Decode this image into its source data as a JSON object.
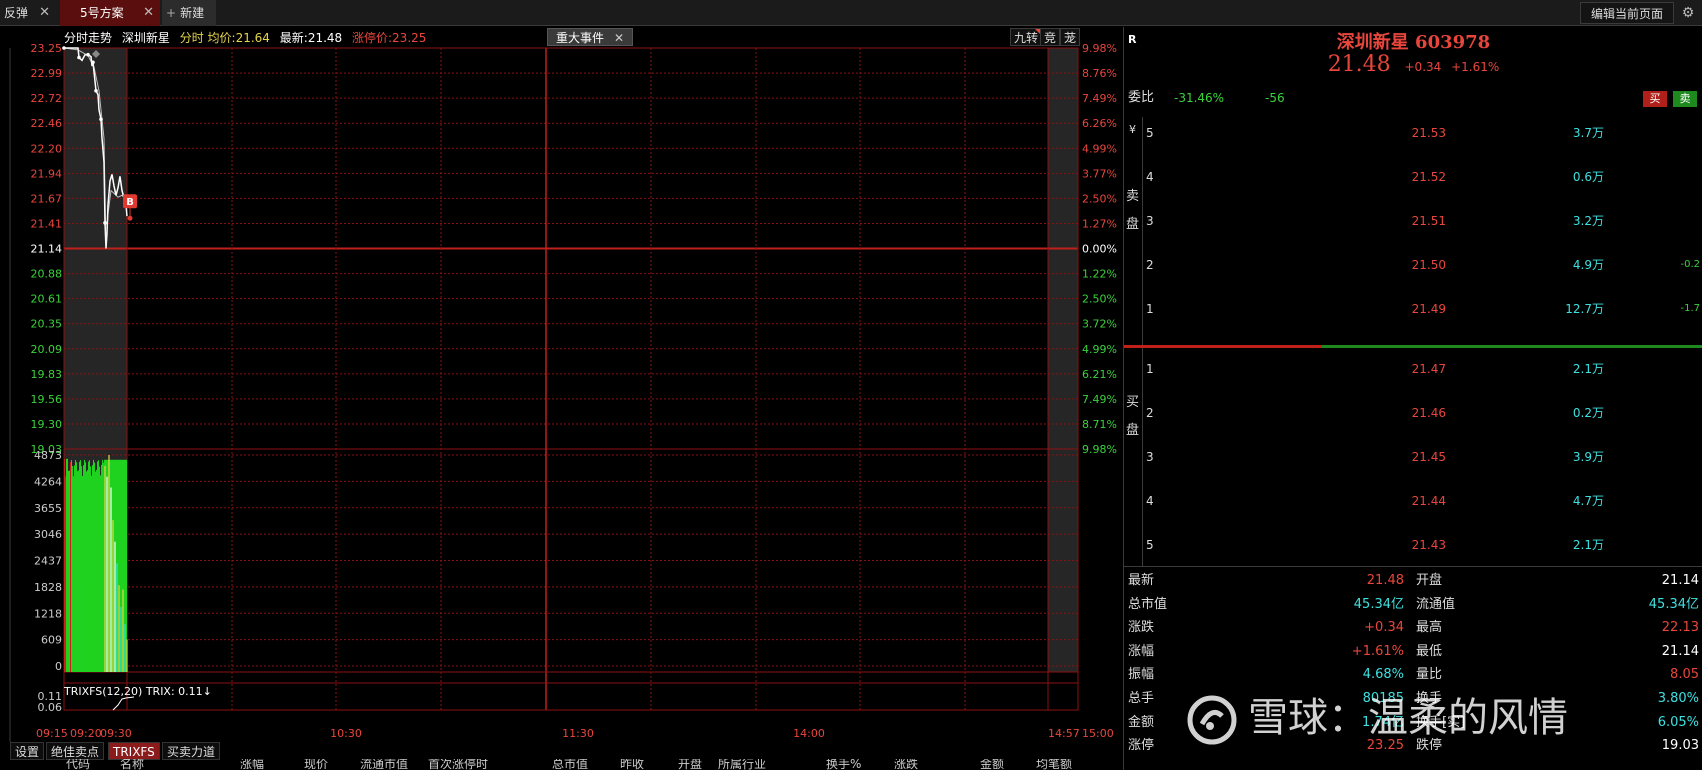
{
  "tabs": [
    {
      "label": "反弹",
      "closable": true
    },
    {
      "label": "5号方案",
      "closable": true,
      "active": true
    },
    {
      "label": "新建",
      "icon": "plus-icon"
    }
  ],
  "toolbar": {
    "edit_page": "编辑当前页面"
  },
  "chart_header": {
    "mode": "分时走势",
    "stock": "深圳新星",
    "sub": "分时",
    "avg_label": "均价:",
    "avg_value": "21.64",
    "last_label": "最新:",
    "last_value": "21.48",
    "limit_label": "涨停价:",
    "limit_value": "23.25",
    "event_tag": "重大事件",
    "btn_jiuzhuan": "九转",
    "btn_jing": "竞",
    "btn_long": "茏"
  },
  "colors": {
    "up": "#e8463c",
    "down": "#3ad23a",
    "grid": "#8c1010",
    "cyan": "#3ee0e0",
    "yellow": "#e6d54a"
  },
  "chart_data": {
    "type": "line",
    "prev_close": 21.14,
    "price_axis": {
      "left_labels": [
        "23.25",
        "22.99",
        "22.72",
        "22.46",
        "22.20",
        "21.94",
        "21.67",
        "21.41",
        "21.14",
        "20.88",
        "20.61",
        "20.35",
        "20.09",
        "19.83",
        "19.56",
        "19.30",
        "19.03"
      ],
      "right_labels": [
        "9.98%",
        "8.76%",
        "7.49%",
        "6.26%",
        "4.99%",
        "3.77%",
        "2.50%",
        "1.27%",
        "0.00%",
        "1.22%",
        "2.50%",
        "3.72%",
        "4.99%",
        "6.21%",
        "7.49%",
        "8.71%",
        "9.98%"
      ],
      "ylim": [
        19.03,
        23.25
      ]
    },
    "time_axis": {
      "labels": [
        "09:15",
        "09:20",
        "09:30",
        "10:30",
        "11:30",
        "14:00",
        "14:57",
        "15:00"
      ]
    },
    "price_series": [
      {
        "name": "price",
        "points": [
          [
            0,
            23.25
          ],
          [
            5,
            23.25
          ],
          [
            14,
            23.25
          ],
          [
            15,
            23.15
          ],
          [
            18,
            23.12
          ],
          [
            21,
            23.18
          ],
          [
            24,
            23.18
          ],
          [
            27,
            23.16
          ],
          [
            28,
            23.06
          ],
          [
            29,
            23.1
          ],
          [
            30,
            23.0
          ],
          [
            31,
            22.9
          ],
          [
            32,
            22.8
          ],
          [
            34,
            22.76
          ],
          [
            35,
            22.6
          ],
          [
            37,
            22.5
          ],
          [
            38,
            22.3
          ],
          [
            40,
            22.05
          ],
          [
            41,
            21.41
          ],
          [
            42,
            21.14
          ],
          [
            43,
            21.3
          ],
          [
            44,
            21.6
          ],
          [
            46,
            21.85
          ],
          [
            48,
            21.92
          ],
          [
            50,
            21.8
          ],
          [
            52,
            21.7
          ],
          [
            54,
            21.78
          ],
          [
            56,
            21.9
          ],
          [
            58,
            21.75
          ],
          [
            60,
            21.67
          ],
          [
            62,
            21.6
          ],
          [
            63,
            21.48
          ]
        ]
      },
      {
        "name": "avg",
        "points": [
          [
            0,
            23.25
          ],
          [
            14,
            23.23
          ],
          [
            24,
            23.17
          ],
          [
            30,
            23.05
          ],
          [
            35,
            22.8
          ],
          [
            40,
            22.3
          ],
          [
            42,
            21.14
          ],
          [
            44,
            21.5
          ],
          [
            47,
            21.75
          ],
          [
            50,
            21.72
          ],
          [
            54,
            21.68
          ],
          [
            58,
            21.7
          ],
          [
            63,
            21.64
          ]
        ]
      }
    ],
    "signal_marker": {
      "label": "B",
      "at_minute": 62
    },
    "volume_axis": {
      "labels": [
        "4873",
        "4264",
        "3655",
        "3046",
        "2437",
        "1828",
        "1218",
        "609",
        "0"
      ],
      "ylim": [
        0,
        4873
      ]
    },
    "trix_axis": {
      "labels": [
        "0.11",
        "0.06"
      ]
    },
    "indicator_label": "TRIXFS(12,20)  TRIX: 0.11↓"
  },
  "bottom_tabs": [
    "设置",
    "绝佳卖点",
    "TRIXFS",
    "买卖力道"
  ],
  "column_headers": [
    "代码",
    "名称",
    "涨幅",
    "现价",
    "流通市值",
    "首次涨停时",
    "总市值",
    "昨收",
    "开盘",
    "所属行业",
    "换手%",
    "涨跌",
    "金额",
    "均笔额"
  ],
  "quote": {
    "tag": "R",
    "name": "深圳新星 603978",
    "price": "21.48",
    "change": "+0.34",
    "change_pct": "+1.61%",
    "weibi_label": "委比",
    "weibi_pct": "-31.46%",
    "weicha": "-56",
    "buy_btn": "买",
    "sell_btn": "卖",
    "yen": "¥",
    "sell_side_label": [
      "卖",
      "盘"
    ],
    "buy_side_label": [
      "买",
      "盘"
    ],
    "asks": [
      {
        "level": "5",
        "price": "21.53",
        "vol": "3.7万",
        "chg": ""
      },
      {
        "level": "4",
        "price": "21.52",
        "vol": "0.6万",
        "chg": ""
      },
      {
        "level": "3",
        "price": "21.51",
        "vol": "3.2万",
        "chg": ""
      },
      {
        "level": "2",
        "price": "21.50",
        "vol": "4.9万",
        "chg": "-0.2"
      },
      {
        "level": "1",
        "price": "21.49",
        "vol": "12.7万",
        "chg": "-1.7"
      }
    ],
    "bids": [
      {
        "level": "1",
        "price": "21.47",
        "vol": "2.1万"
      },
      {
        "level": "2",
        "price": "21.46",
        "vol": "0.2万"
      },
      {
        "level": "3",
        "price": "21.45",
        "vol": "3.9万"
      },
      {
        "level": "4",
        "price": "21.44",
        "vol": "4.7万"
      },
      {
        "level": "5",
        "price": "21.43",
        "vol": "2.1万"
      }
    ],
    "stats": [
      {
        "k1": "最新",
        "v1": "21.48",
        "c1": "red",
        "k2": "开盘",
        "v2": "21.14",
        "c2": "white"
      },
      {
        "k1": "总市值",
        "v1": "45.34亿",
        "c1": "cyan",
        "k2": "流通值",
        "v2": "45.34亿",
        "c2": "cyan"
      },
      {
        "k1": "涨跌",
        "v1": "+0.34",
        "c1": "red",
        "k2": "最高",
        "v2": "22.13",
        "c2": "red"
      },
      {
        "k1": "涨幅",
        "v1": "+1.61%",
        "c1": "red",
        "k2": "最低",
        "v2": "21.14",
        "c2": "white"
      },
      {
        "k1": "振幅",
        "v1": "4.68%",
        "c1": "cyan",
        "k2": "量比",
        "v2": "8.05",
        "c2": "red"
      },
      {
        "k1": "总手",
        "v1": "80185",
        "c1": "cyan",
        "k2": "换手",
        "v2": "3.80%",
        "c2": "cyan"
      },
      {
        "k1": "金额",
        "v1": "1.74亿",
        "c1": "cyan",
        "k2": "换手[实]",
        "v2": "6.05%",
        "c2": "cyan"
      },
      {
        "k1": "涨停",
        "v1": "23.25",
        "c1": "red",
        "k2": "跌停",
        "v2": "19.03",
        "c2": "white"
      }
    ]
  },
  "watermark": "雪球：温柔的风情"
}
